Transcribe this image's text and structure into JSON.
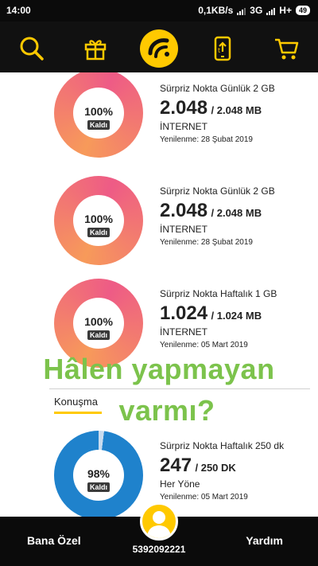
{
  "status_bar": {
    "time": "14:00",
    "speed": "0,1KB/s",
    "network_1": "3G",
    "network_2": "H+",
    "battery": "49"
  },
  "top_nav": {
    "icons": [
      "search-icon",
      "gift-icon",
      "turkcell-logo-icon",
      "phone-upload-icon",
      "cart-icon"
    ],
    "accent_color": "#ffc900"
  },
  "cards": [
    {
      "name": "Sürpriz Nokta Günlük 2 GB",
      "amount": "2.048",
      "total": "/ 2.048 MB",
      "type": "İNTERNET",
      "renew": "Yenilenme: 28 Şubat 2019",
      "percent_label": "100%",
      "remaining_label": "Kaldı",
      "fill_percent": 100
    },
    {
      "name": "Sürpriz Nokta Günlük 2 GB",
      "amount": "2.048",
      "total": "/ 2.048 MB",
      "type": "İNTERNET",
      "renew": "Yenilenme: 28 Şubat 2019",
      "percent_label": "100%",
      "remaining_label": "Kaldı",
      "fill_percent": 100
    },
    {
      "name": "Sürpriz Nokta Haftalık 1 GB",
      "amount": "1.024",
      "total": "/ 1.024 MB",
      "type": "İNTERNET",
      "renew": "Yenilenme: 05 Mart 2019",
      "percent_label": "100%",
      "remaining_label": "Kaldı",
      "fill_percent": 100
    },
    {
      "name": "Sürpriz Nokta Haftalık 250 dk",
      "amount": "247",
      "total": "/ 250 DK",
      "type": "Her Yöne",
      "renew": "Yenilenme: 05 Mart 2019",
      "percent_label": "98%",
      "remaining_label": "Kaldı",
      "fill_percent": 98
    }
  ],
  "section": {
    "title": "Konuşma"
  },
  "overlay": {
    "line1": "Hâlen yapmayan",
    "line2": "varmı?",
    "color": "#7cc34c"
  },
  "bottom_bar": {
    "left_label": "Bana Özel",
    "right_label": "Yardım",
    "phone_number": "5392092221"
  },
  "colors": {
    "internet_ring_start": "#f79a5a",
    "internet_ring_end": "#ee5b86",
    "voice_ring": "#1f82cc",
    "voice_ring_used": "#c9dcef"
  }
}
